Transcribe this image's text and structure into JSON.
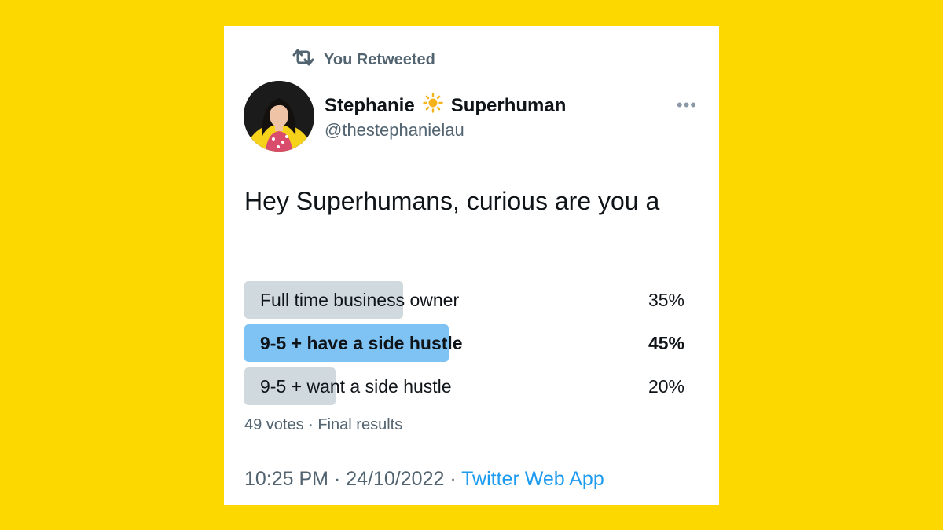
{
  "retweet_label": "You Retweeted",
  "author": {
    "display_name_first": "Stephanie",
    "display_name_emoji_icon": "sun-icon",
    "display_name_last": "Superhuman",
    "handle": "@thestephanielau"
  },
  "tweet": {
    "text": "Hey Superhumans, curious are you a"
  },
  "poll": {
    "options": [
      {
        "label": "Full time business owner",
        "percent_text": "35%",
        "percent": 35,
        "winner": false
      },
      {
        "label": "9-5 + have a side hustle",
        "percent_text": "45%",
        "percent": 45,
        "winner": true
      },
      {
        "label": "9-5 + want a side hustle",
        "percent_text": "20%",
        "percent": 20,
        "winner": false
      }
    ],
    "meta": "49 votes · Final results"
  },
  "footer": {
    "time": "10:25 PM",
    "date": "24/10/2022",
    "separator": "·",
    "source": "Twitter Web App"
  },
  "colors": {
    "background": "#FDD800",
    "poll_bar": "#CFD9DE",
    "poll_bar_winner": "#7FC3F5",
    "link": "#1D9BF0",
    "secondary_text": "#536471"
  }
}
